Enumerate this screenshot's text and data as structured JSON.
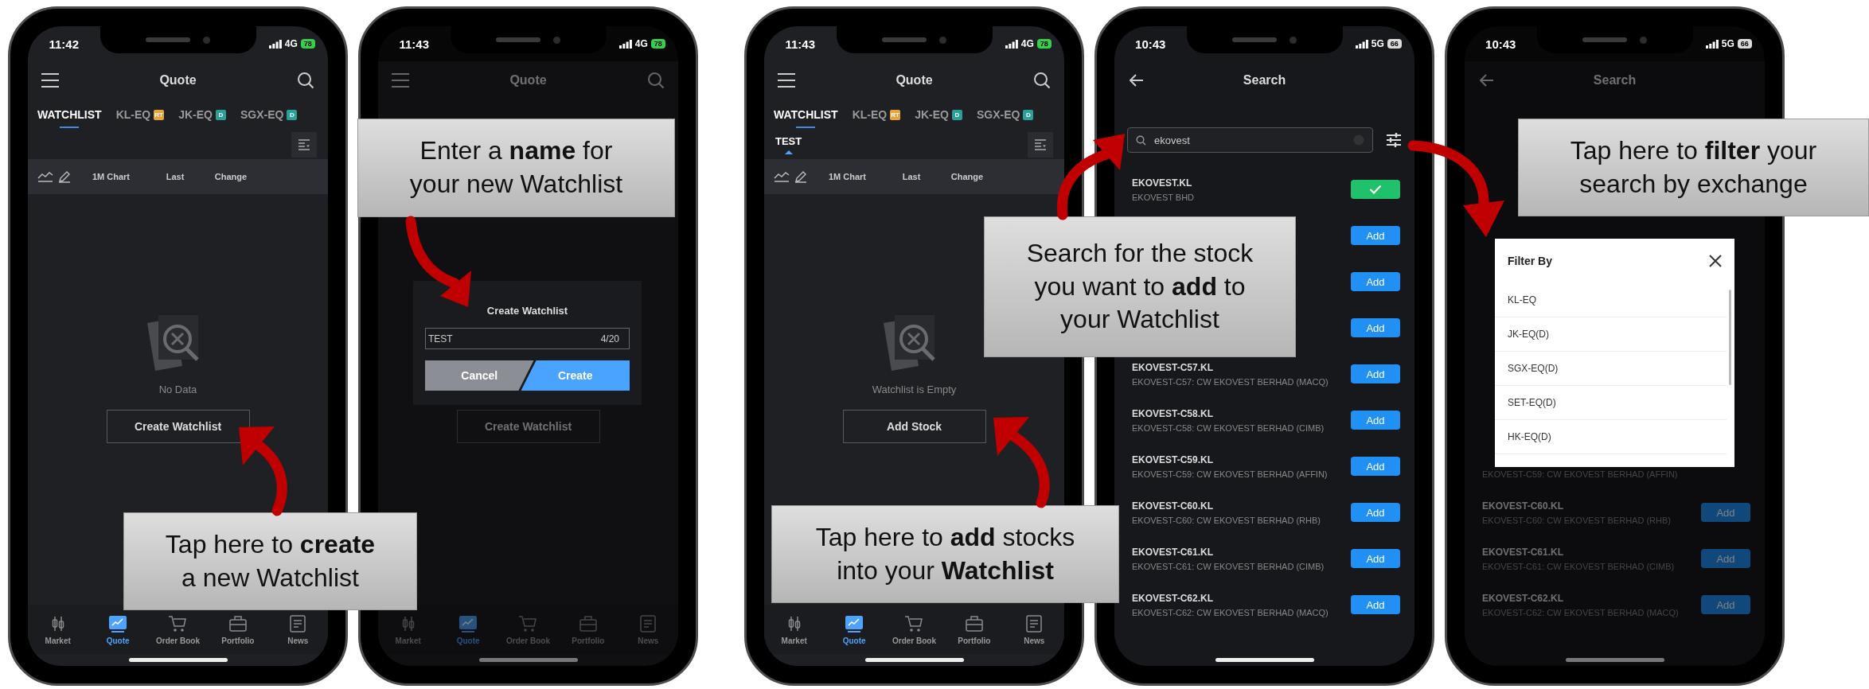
{
  "panels": [
    {
      "phones": [
        {
          "kind": "watchlist",
          "dimmed": false,
          "status": {
            "time": "11:42",
            "network": "4G",
            "battery": "78",
            "charging": true
          },
          "title": "Quote",
          "tabs": [
            {
              "label": "WATCHLIST",
              "selected": true
            },
            {
              "label": "KL-EQ",
              "badge": "RT",
              "color": "#e8a33c",
              "selected": false
            },
            {
              "label": "JK-EQ",
              "badge": "D",
              "color": "#2aa198",
              "selected": false
            },
            {
              "label": "SGX-EQ",
              "badge": "D",
              "color": "#2aa198",
              "selected": false
            }
          ],
          "columns": [
            "1M Chart",
            "Last",
            "Change"
          ],
          "empty": {
            "message": "No Data",
            "button": "Create Watchlist"
          },
          "nav": [
            {
              "label": "Market",
              "selected": false
            },
            {
              "label": "Quote",
              "selected": true
            },
            {
              "label": "Order Book",
              "selected": false
            },
            {
              "label": "Portfolio",
              "selected": false
            },
            {
              "label": "News",
              "selected": false
            }
          ]
        },
        {
          "kind": "watchlist",
          "dimmed": true,
          "status": {
            "time": "11:43",
            "network": "4G",
            "battery": "78",
            "charging": true
          },
          "title": "Quote",
          "empty": {
            "button": "Create Watchlist"
          },
          "nav": [
            {
              "label": "Market",
              "selected": false
            },
            {
              "label": "Quote",
              "selected": true
            },
            {
              "label": "Order Book",
              "selected": false
            },
            {
              "label": "Portfolio",
              "selected": false
            },
            {
              "label": "News",
              "selected": false
            }
          ],
          "dialog": {
            "title": "Create Watchlist",
            "value": "TEST",
            "counter": "4/20",
            "cancel": "Cancel",
            "confirm": "Create"
          }
        }
      ]
    },
    {
      "phones": [
        {
          "kind": "watchlist",
          "dimmed": false,
          "status": {
            "time": "11:43",
            "network": "4G",
            "battery": "78",
            "charging": true
          },
          "title": "Quote",
          "tabs": [
            {
              "label": "WATCHLIST",
              "selected": true
            },
            {
              "label": "KL-EQ",
              "badge": "RT",
              "color": "#e8a33c",
              "selected": false
            },
            {
              "label": "JK-EQ",
              "badge": "D",
              "color": "#2aa198",
              "selected": false
            },
            {
              "label": "SGX-EQ",
              "badge": "D",
              "color": "#2aa198",
              "selected": false
            }
          ],
          "subtabs": [
            {
              "label": "TEST",
              "selected": true
            }
          ],
          "columns": [
            "1M Chart",
            "Last",
            "Change"
          ],
          "empty": {
            "message": "Watchlist is Empty",
            "button": "Add Stock"
          },
          "nav": [
            {
              "label": "Market",
              "selected": false
            },
            {
              "label": "Quote",
              "selected": true
            },
            {
              "label": "Order Book",
              "selected": false
            },
            {
              "label": "Portfolio",
              "selected": false
            },
            {
              "label": "News",
              "selected": false
            }
          ]
        },
        {
          "kind": "search",
          "dimmed": false,
          "status": {
            "time": "10:43",
            "network": "5G",
            "battery": "66",
            "charging": false
          },
          "title": "Search",
          "search": {
            "value": "ekovest"
          },
          "rows": [
            {
              "code": "EKOVEST.KL",
              "name": "EKOVEST BHD",
              "added": true
            },
            {
              "added": false,
              "action": "Add"
            },
            {
              "added": false,
              "action": "Add"
            },
            {
              "added": false,
              "action": "Add"
            },
            {
              "code": "EKOVEST-C57.KL",
              "name": "EKOVEST-C57: CW EKOVEST BERHAD (MACQ)",
              "added": false,
              "action": "Add"
            },
            {
              "code": "EKOVEST-C58.KL",
              "name": "EKOVEST-C58: CW EKOVEST BERHAD (CIMB)",
              "added": false,
              "action": "Add"
            },
            {
              "code": "EKOVEST-C59.KL",
              "name": "EKOVEST-C59: CW EKOVEST BERHAD (AFFIN)",
              "added": false,
              "action": "Add"
            },
            {
              "code": "EKOVEST-C60.KL",
              "name": "EKOVEST-C60: CW EKOVEST BERHAD (RHB)",
              "added": false,
              "action": "Add"
            },
            {
              "code": "EKOVEST-C61.KL",
              "name": "EKOVEST-C61: CW EKOVEST BERHAD (CIMB)",
              "added": false,
              "action": "Add"
            },
            {
              "code": "EKOVEST-C62.KL",
              "name": "EKOVEST-C62: CW EKOVEST BERHAD (MACQ)",
              "added": false,
              "action": "Add"
            }
          ]
        },
        {
          "kind": "search",
          "dimmed": true,
          "status": {
            "time": "10:43",
            "network": "5G",
            "battery": "66",
            "charging": false
          },
          "title": "Search",
          "rows": [
            {
              "name": "EKOVEST-C59: CW EKOVEST BERHAD (AFFIN)"
            },
            {
              "code": "EKOVEST-C60.KL",
              "name": "EKOVEST-C60: CW EKOVEST BERHAD (RHB)",
              "added": false,
              "action": "Add"
            },
            {
              "code": "EKOVEST-C61.KL",
              "name": "EKOVEST-C61: CW EKOVEST BERHAD (CIMB)",
              "added": false,
              "action": "Add"
            },
            {
              "code": "EKOVEST-C62.KL",
              "name": "EKOVEST-C62: CW EKOVEST BERHAD (MACQ)",
              "added": false,
              "action": "Add"
            }
          ],
          "filter": {
            "title": "Filter By",
            "options": [
              "KL-EQ",
              "JK-EQ(D)",
              "SGX-EQ(D)",
              "SET-EQ(D)",
              "HK-EQ(D)"
            ]
          }
        }
      ]
    }
  ],
  "callouts": [
    {
      "text": "Tap here to **create**\na new Watchlist"
    },
    {
      "text": "Enter a **name** for\nyour new Watchlist"
    },
    {
      "text": "Tap here to **add** stocks\ninto your **Watchlist**"
    },
    {
      "text": "Search for the stock\nyou want to **add** to\nyour Watchlist"
    },
    {
      "text": "Tap here to **filter** your\nsearch by exchange"
    }
  ]
}
